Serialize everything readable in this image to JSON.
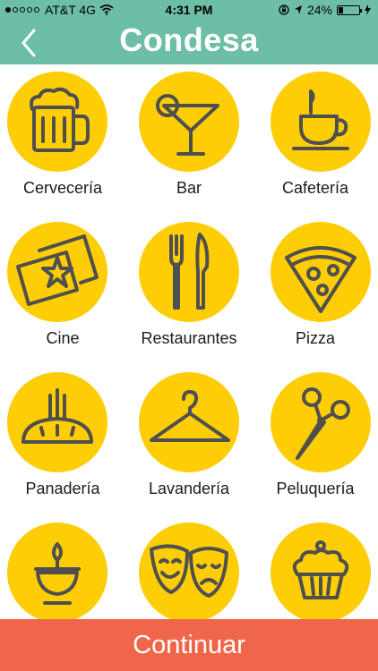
{
  "status_bar": {
    "carrier": "AT&T 4G",
    "time": "4:31 PM",
    "battery": "24%",
    "battery_level": 0.24
  },
  "header": {
    "title": "Condesa",
    "back_icon": "chevron-left-icon"
  },
  "categories": [
    {
      "label": "Cervecería",
      "icon": "beer-mug-icon"
    },
    {
      "label": "Bar",
      "icon": "cocktail-glass-icon"
    },
    {
      "label": "Cafetería",
      "icon": "coffee-cup-icon"
    },
    {
      "label": "Cine",
      "icon": "movie-tickets-icon"
    },
    {
      "label": "Restaurantes",
      "icon": "fork-knife-icon"
    },
    {
      "label": "Pizza",
      "icon": "pizza-slice-icon"
    },
    {
      "label": "Panadería",
      "icon": "bread-icon"
    },
    {
      "label": "Lavandería",
      "icon": "hanger-icon"
    },
    {
      "label": "Peluquería",
      "icon": "scissors-icon"
    },
    {
      "label": "",
      "icon": "candle-icon"
    },
    {
      "label": "",
      "icon": "theater-masks-icon"
    },
    {
      "label": "",
      "icon": "cupcake-icon"
    }
  ],
  "footer": {
    "continue_label": "Continuar"
  },
  "colors": {
    "header": "#6dbea6",
    "circle": "#fdcd06",
    "icon_stroke": "#4f4f4f",
    "continue_button": "#f0664b"
  }
}
